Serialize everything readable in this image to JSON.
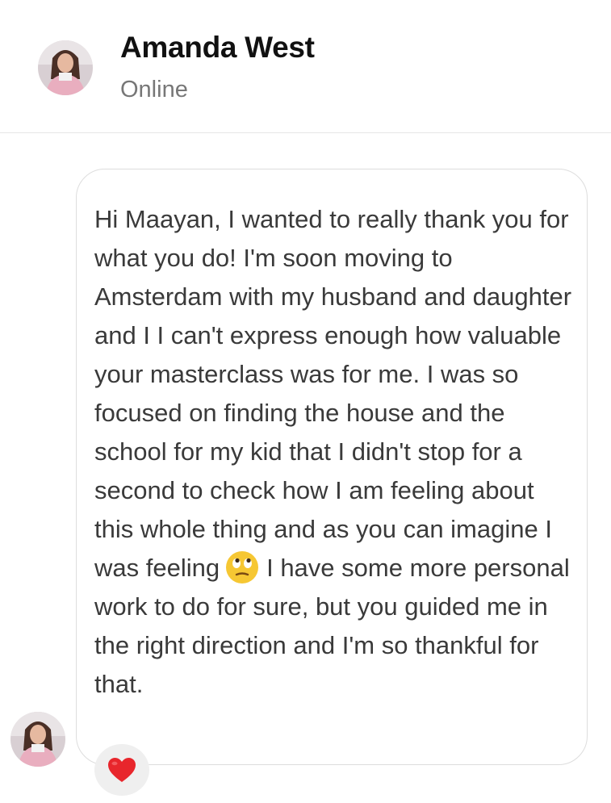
{
  "header": {
    "contact_name": "Amanda West",
    "status": "Online",
    "avatar_icon": "profile-photo-avatar"
  },
  "message": {
    "text_part1": "Hi Maayan, I wanted to really thank you for what you do! I'm soon moving to Amsterdam with my husband and daughter and I I can't express enough how valuable your masterclass was for me. I was so focused on finding the house and the school for my kid that I didn't stop for a second to check how I am feeling about this whole thing and as you can imagine I was feeling",
    "emoji": "face-with-rolling-eyes-emoji",
    "text_part2": "I have some more personal work to do for sure, but you guided me in the right direction and I'm so thankful for that."
  },
  "reaction": {
    "icon": "red-heart-icon",
    "color": "#e8262c"
  },
  "colors": {
    "name": "#111111",
    "status": "#777777",
    "message_text": "#3a3a3a",
    "bubble_border": "#dddddd",
    "reaction_bg": "#efefef"
  }
}
